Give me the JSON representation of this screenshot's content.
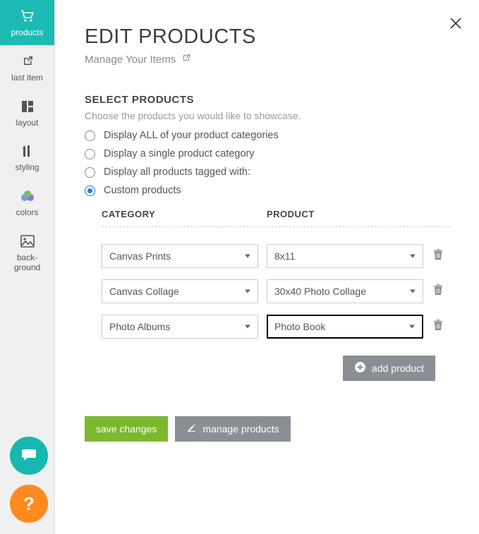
{
  "sidebar": {
    "items": [
      {
        "label": "products",
        "icon": "cart",
        "active": true
      },
      {
        "label": "last item",
        "icon": "external"
      },
      {
        "label": "layout",
        "icon": "grid"
      },
      {
        "label": "styling",
        "icon": "styling"
      },
      {
        "label": "colors",
        "icon": "palette"
      },
      {
        "label": "back-\nground",
        "icon": "image"
      }
    ]
  },
  "header": {
    "title": "EDIT PRODUCTS",
    "subtitle": "Manage Your Items"
  },
  "section": {
    "title": "SELECT PRODUCTS",
    "description": "Choose the products you would like to showcase.",
    "options": [
      "Display ALL of your product categories",
      "Display a single product category",
      "Display all products tagged with:",
      "Custom products"
    ],
    "selected_index": 3
  },
  "table": {
    "headers": {
      "category": "CATEGORY",
      "product": "PRODUCT"
    },
    "rows": [
      {
        "category": "Canvas Prints",
        "product": "8x11"
      },
      {
        "category": "Canvas Collage",
        "product": "30x40 Photo Collage"
      },
      {
        "category": "Photo Albums",
        "product": "Photo Book",
        "product_focused": true
      }
    ]
  },
  "buttons": {
    "add_product": "add product",
    "save_changes": "save changes",
    "manage_products": "manage products"
  },
  "fab": {
    "help": "?"
  }
}
